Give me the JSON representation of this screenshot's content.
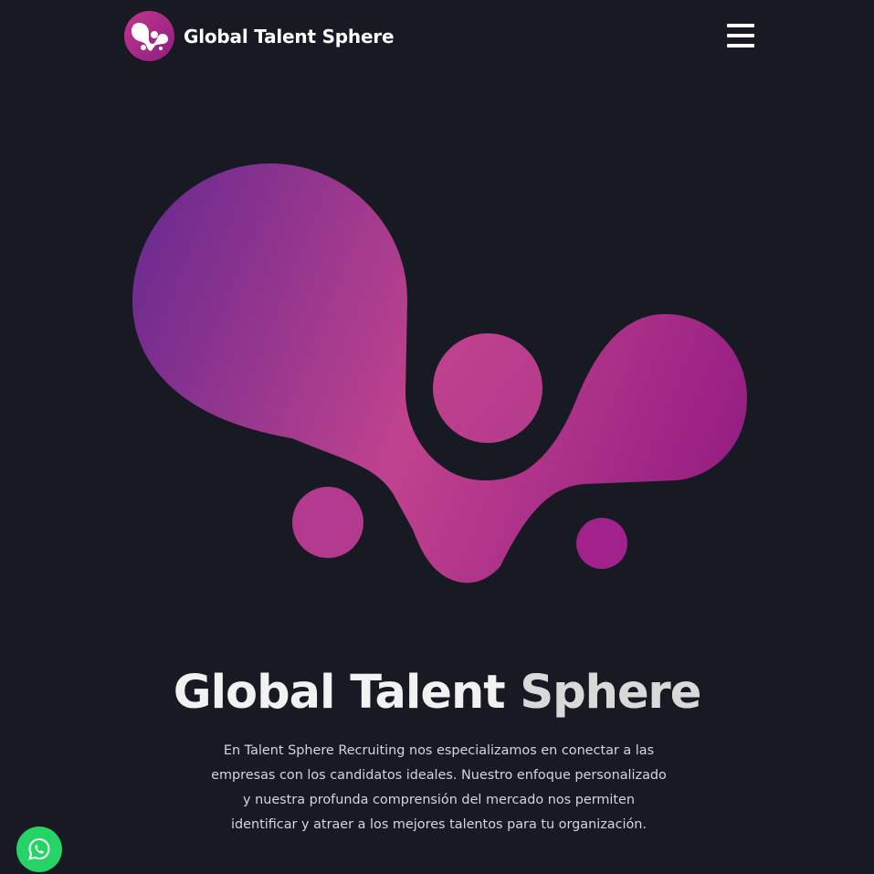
{
  "header": {
    "brand_name": "Global Talent Sphere",
    "logo_icon": "talent-sphere-logo",
    "menu_icon": "hamburger-menu-icon"
  },
  "hero": {
    "title_part1": "Global Talent",
    "title_part2": "Sphere",
    "description": "En Talent Sphere Recruiting nos especializamos en conectar a las empresas con los candidatos ideales. Nuestro enfoque personalizado y nuestra profunda comprensión del mercado nos permiten identificar y atraer a los mejores talentos para tu organización."
  },
  "floating": {
    "whatsapp_icon": "whatsapp-icon"
  },
  "colors": {
    "background": "#171a22",
    "gradient_purple": "#6a2a8f",
    "gradient_pink": "#c0428e",
    "gradient_magenta": "#9a1f84",
    "whatsapp_green": "#25d366"
  }
}
